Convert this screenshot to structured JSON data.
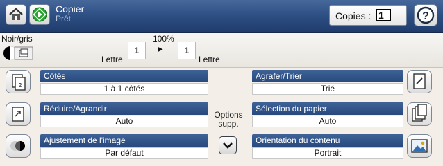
{
  "header": {
    "title": "Copier",
    "subtitle": "Prêt",
    "copies_label": "Copies :",
    "copies_value": "1"
  },
  "icons": {
    "home": "home-icon",
    "start": "start-icon",
    "help": "help-icon"
  },
  "preview": {
    "color_mode": "Noir/gris",
    "zoom": "100%",
    "source_paper": "Lettre",
    "source_count": "1",
    "dest_count": "1",
    "dest_paper": "Lettre"
  },
  "options": {
    "sides": {
      "label": "Côtés",
      "value": "1 à 1 côtés"
    },
    "reduce": {
      "label": "Réduire/Agrandir",
      "value": "Auto"
    },
    "adjust": {
      "label": "Ajustement de l'image",
      "value": "Par défaut"
    },
    "staple": {
      "label": "Agrafer/Trier",
      "value": "Trié"
    },
    "paper": {
      "label": "Sélection du papier",
      "value": "Auto"
    },
    "orientation": {
      "label": "Orientation du contenu",
      "value": "Portrait"
    },
    "more_line1": "Options",
    "more_line2": "supp."
  }
}
